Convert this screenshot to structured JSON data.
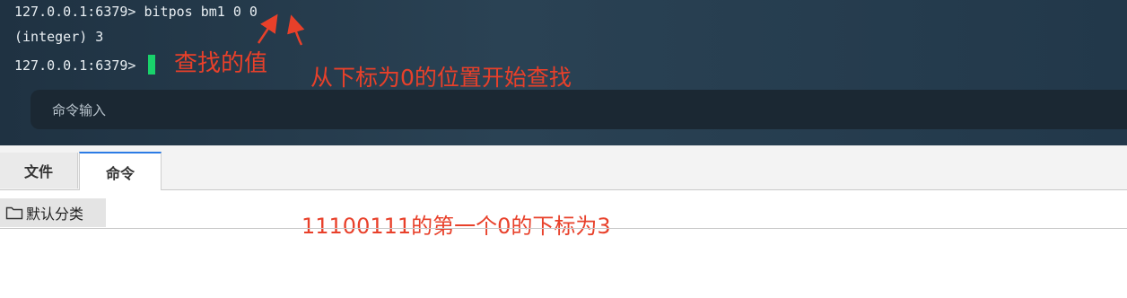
{
  "terminal": {
    "lines": [
      "127.0.0.1:6379> bitpos bm1 0 0",
      "(integer) 3",
      "127.0.0.1:6379> "
    ],
    "cursor_color": "#19d26b",
    "input_placeholder": "命令输入"
  },
  "annotations": {
    "value_to_find": "查找的值",
    "start_index": "从下标为0的位置开始查找",
    "explanation": "11100111的第一个0的下标为3",
    "color": "#e8402a"
  },
  "tabs": [
    {
      "label": "文件",
      "active": false
    },
    {
      "label": "命令",
      "active": true
    }
  ],
  "category": {
    "label": "默认分类",
    "icon": "folder-icon"
  },
  "drag_handle": "....."
}
